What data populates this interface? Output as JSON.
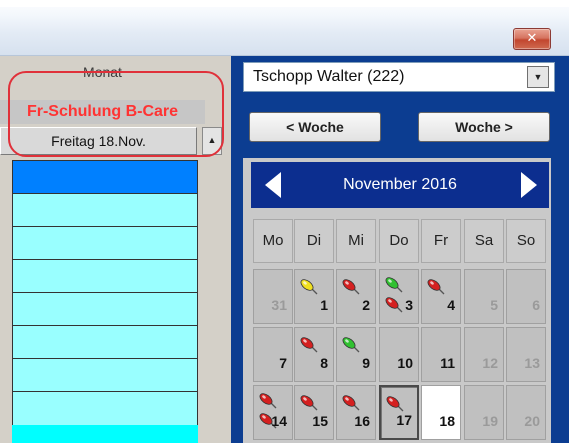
{
  "window": {
    "close_glyph": "✕"
  },
  "left_panel": {
    "view_label": "Monat",
    "event_title": "Fr-Schulung B-Care",
    "day_label": "Freitag 18.Nov.",
    "spinner_glyph": "▲"
  },
  "person_select": {
    "value": "Tschopp Walter  (222)",
    "arrow_glyph": "▼"
  },
  "week_nav": {
    "prev_label": "< Woche",
    "next_label": "Woche >"
  },
  "calendar": {
    "month_label": "November 2016",
    "weekdays": [
      "Mo",
      "Di",
      "Mi",
      "Do",
      "Fr",
      "Sa",
      "So"
    ],
    "weeks": [
      [
        {
          "day": "31",
          "muted": true
        },
        {
          "day": "1",
          "pins": [
            "yellow"
          ]
        },
        {
          "day": "2",
          "pins": [
            "red"
          ]
        },
        {
          "day": "3",
          "pins": [
            "green",
            "red"
          ]
        },
        {
          "day": "4",
          "pins": [
            "red"
          ]
        },
        {
          "day": "5",
          "muted": true
        },
        {
          "day": "6",
          "muted": true
        }
      ],
      [
        {
          "day": "7"
        },
        {
          "day": "8",
          "pins": [
            "red"
          ]
        },
        {
          "day": "9",
          "pins": [
            "green"
          ]
        },
        {
          "day": "10"
        },
        {
          "day": "11"
        },
        {
          "day": "12",
          "muted": true
        },
        {
          "day": "13",
          "muted": true
        }
      ],
      [
        {
          "day": "14",
          "pins": [
            "red",
            "red"
          ]
        },
        {
          "day": "15",
          "pins": [
            "red"
          ]
        },
        {
          "day": "16",
          "pins": [
            "red"
          ]
        },
        {
          "day": "17",
          "pins": [
            "red"
          ],
          "framed": true
        },
        {
          "day": "18",
          "today": true
        },
        {
          "day": "19",
          "muted": true
        },
        {
          "day": "20",
          "muted": true
        }
      ]
    ]
  },
  "colors": {
    "panel_blue": "#0c3d91",
    "month_bar": "#0c2e8f",
    "event_red": "#ff3333",
    "slot_selected": "#0080ff",
    "slot_cyan": "#99ffff",
    "pin_red": "#d42020",
    "pin_yellow": "#f0e020",
    "pin_green": "#30c030"
  }
}
